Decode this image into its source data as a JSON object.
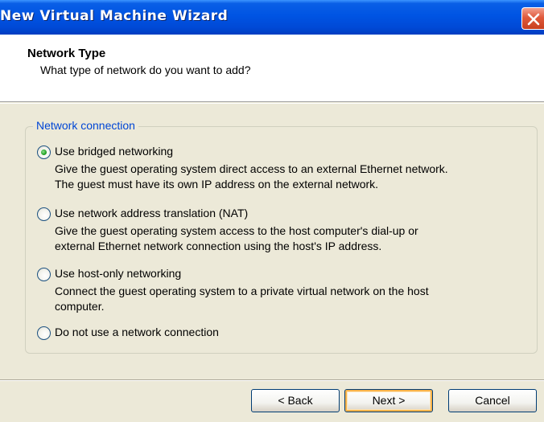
{
  "window": {
    "title": "New Virtual Machine Wizard"
  },
  "header": {
    "title": "Network Type",
    "subtitle": "What type of network do you want to add?"
  },
  "network_group": {
    "legend": "Network connection",
    "selected": "bridged",
    "options": [
      {
        "id": "bridged",
        "label": "Use bridged networking",
        "selected": true,
        "description_lines": [
          "Give the guest operating system direct access to an external Ethernet network.",
          "The guest must have its own IP address on the external network."
        ]
      },
      {
        "id": "nat",
        "label": "Use network address translation (NAT)",
        "selected": false,
        "description_lines": [
          "Give the guest operating system access to the host computer's dial-up or",
          "external Ethernet network connection using the host's IP address."
        ]
      },
      {
        "id": "hostonly",
        "label": "Use host-only networking",
        "selected": false,
        "description_lines": [
          "Connect the guest operating system to a private virtual network on the host",
          "computer."
        ]
      },
      {
        "id": "none",
        "label": "Do not use a network connection",
        "selected": false,
        "description_lines": []
      }
    ]
  },
  "buttons": {
    "back": "< Back",
    "next": "Next >",
    "cancel": "Cancel"
  },
  "colors": {
    "titlebar": "#0054e3",
    "legend_text": "#0046d5",
    "radio_selected": "#21a121",
    "default_button_highlight": "#f8b34a"
  }
}
